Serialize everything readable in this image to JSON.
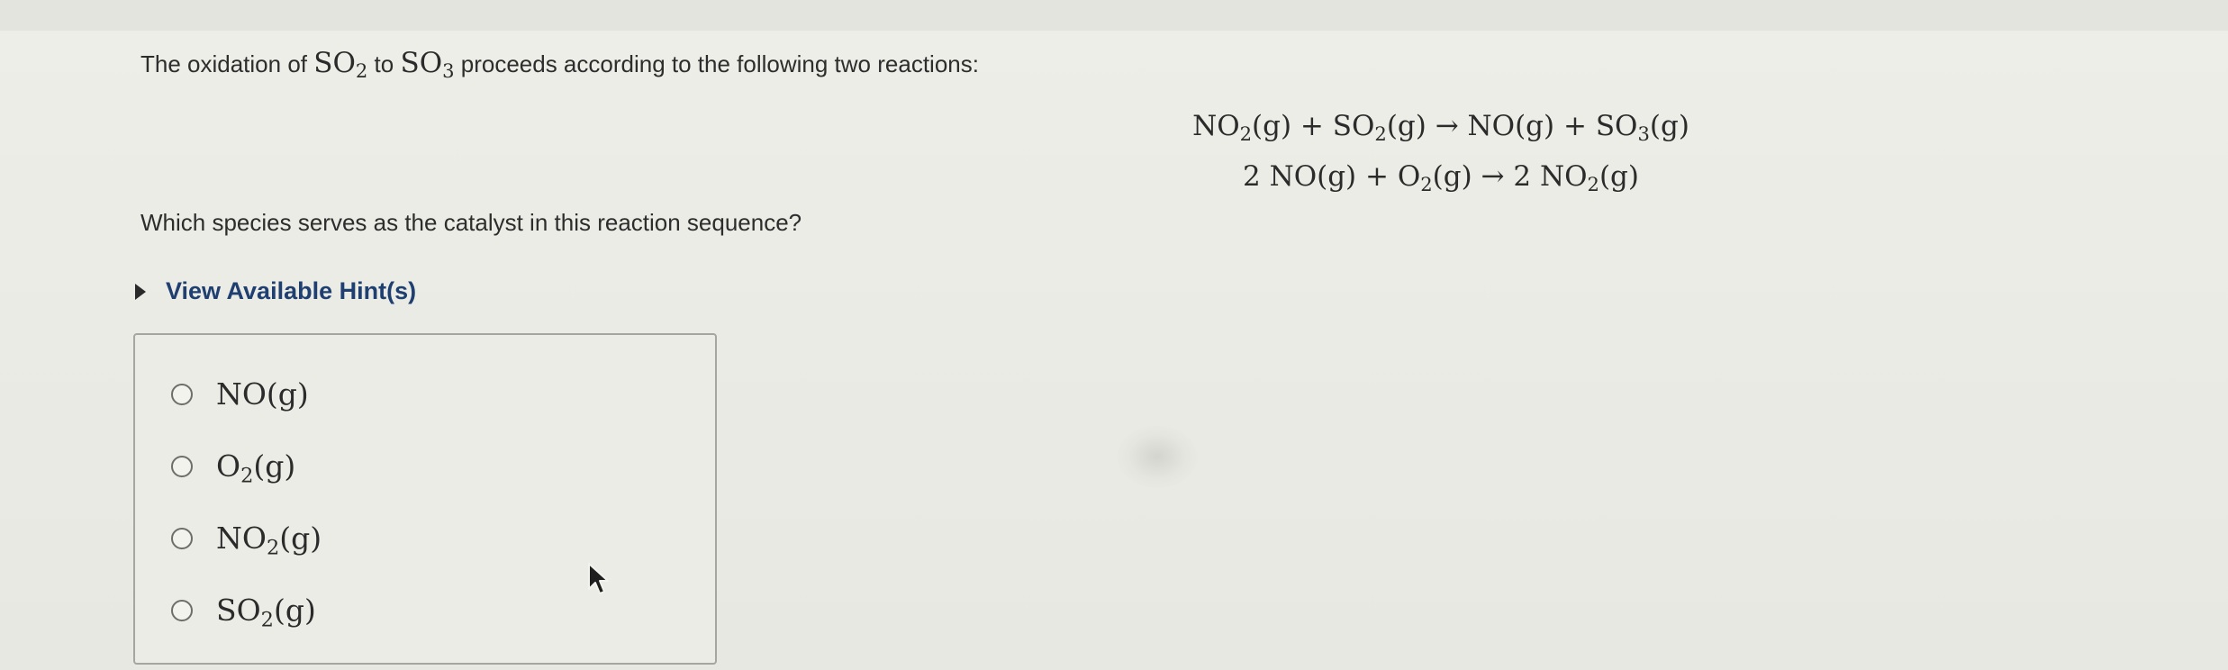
{
  "question": {
    "intro_before": "The oxidation of ",
    "species_from": {
      "main": "SO",
      "sub": "2"
    },
    "intro_middle": " to ",
    "species_to": {
      "main": "SO",
      "sub": "3"
    },
    "intro_after": " proceeds according to the following two reactions:",
    "prompt": "Which species serves as the catalyst in this reaction sequence?"
  },
  "reactions": [
    {
      "parts": [
        {
          "main": "NO",
          "sub": "2",
          "post": "(g) + "
        },
        {
          "main": "SO",
          "sub": "2",
          "post": "(g) → NO(g) + "
        },
        {
          "main": "SO",
          "sub": "3",
          "post": "(g)"
        }
      ]
    },
    {
      "parts": [
        {
          "main": "2 NO(g) + O",
          "sub": "2",
          "post": "(g) → 2 NO"
        },
        {
          "main": "",
          "sub": "2",
          "post": "(g)"
        }
      ]
    }
  ],
  "hint": {
    "label": "View Available Hint(s)"
  },
  "options": [
    {
      "main": "NO(g)",
      "sub": "",
      "post": "",
      "selected": false
    },
    {
      "main": "O",
      "sub": "2",
      "post": "(g)",
      "selected": false
    },
    {
      "main": "NO",
      "sub": "2",
      "post": "(g)",
      "selected": false
    },
    {
      "main": "SO",
      "sub": "2",
      "post": "(g)",
      "selected": false
    }
  ],
  "colors": {
    "background": "#ecece6",
    "hint_link": "#1f3f70",
    "text": "#2b2b2b"
  }
}
